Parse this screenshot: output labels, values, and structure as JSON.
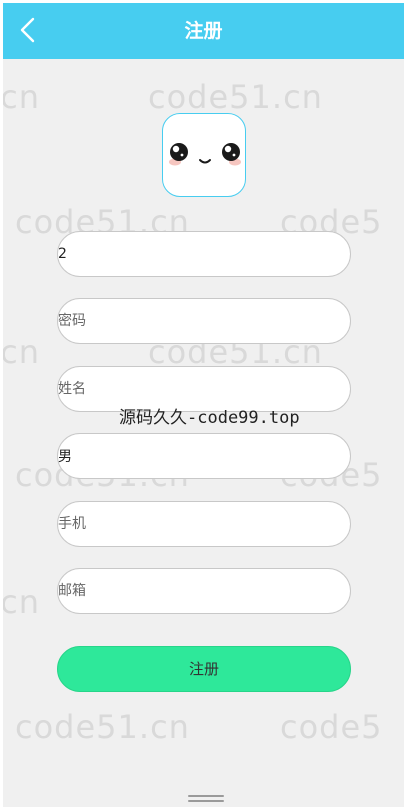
{
  "header": {
    "title": "注册",
    "back_icon": "chevron-left-icon",
    "background_color": "#47cdf0"
  },
  "avatar": {
    "icon": "cute-face-avatar-icon",
    "border_color": "#47cdf0"
  },
  "form": {
    "username": {
      "value": "2",
      "placeholder": ""
    },
    "password": {
      "placeholder": "密码"
    },
    "name": {
      "placeholder": "姓名"
    },
    "gender": {
      "value": "男"
    },
    "phone": {
      "placeholder": "手机"
    },
    "email": {
      "placeholder": "邮箱"
    },
    "submit_label": "注册",
    "submit_color": "#2ee89a"
  },
  "watermarks": {
    "site": "code51.cn",
    "site_left": ".cn",
    "site_right": "code5",
    "center": "源码久久-code99.top"
  }
}
